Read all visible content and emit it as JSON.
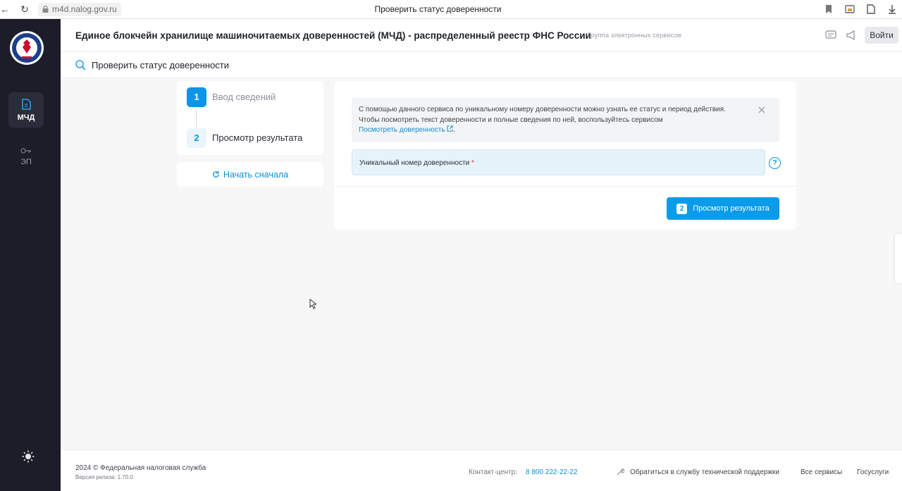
{
  "browser": {
    "url": "m4d.nalog.gov.ru",
    "tab_title": "Проверить статус доверенности"
  },
  "sidebar": {
    "items": [
      {
        "label": "МЧД",
        "icon": "document-icon",
        "active": true
      },
      {
        "label": "ЭП",
        "icon": "key-icon",
        "active": false
      }
    ]
  },
  "header": {
    "title": "Единое блокчейн хранилище машиночитаемых доверенностей (МЧД) - распределенный реестр ФНС России",
    "subtitle": "Группа электронных сервисов",
    "login_label": "Войти"
  },
  "subheader": {
    "title": "Проверить статус доверенности"
  },
  "stepper": {
    "steps": [
      {
        "num": "1",
        "label": "Ввод сведений"
      },
      {
        "num": "2",
        "label": "Просмотр результата"
      }
    ],
    "restart_label": "Начать сначала"
  },
  "form": {
    "info_line1": "С помощью данного сервиса по уникальному номеру доверенности можно узнать ее статус и период действия.",
    "info_line2": "Чтобы посмотреть текст доверенности и полные сведения по ней, воспользуйтесь сервисом",
    "info_link": "Посмотреть доверенность",
    "field_label": "Уникальный номер доверенности",
    "required_mark": "*",
    "help_glyph": "?",
    "submit_num": "2",
    "submit_label": "Просмотр результата"
  },
  "footer": {
    "copyright": "2024 ©  Федеральная налоговая служба",
    "version": "Версия релиза: 1.70.0",
    "contact_label": "Контакт-центр:",
    "phone": "8 800 222-22-22",
    "support": "Обратиться в службу технической поддержки",
    "all_services": "Все сервисы",
    "gosuslugi": "Госуслуги"
  },
  "colors": {
    "accent": "#0a95e8",
    "sidebar_bg": "#1c1d28",
    "page_bg": "#f7f7f8"
  }
}
